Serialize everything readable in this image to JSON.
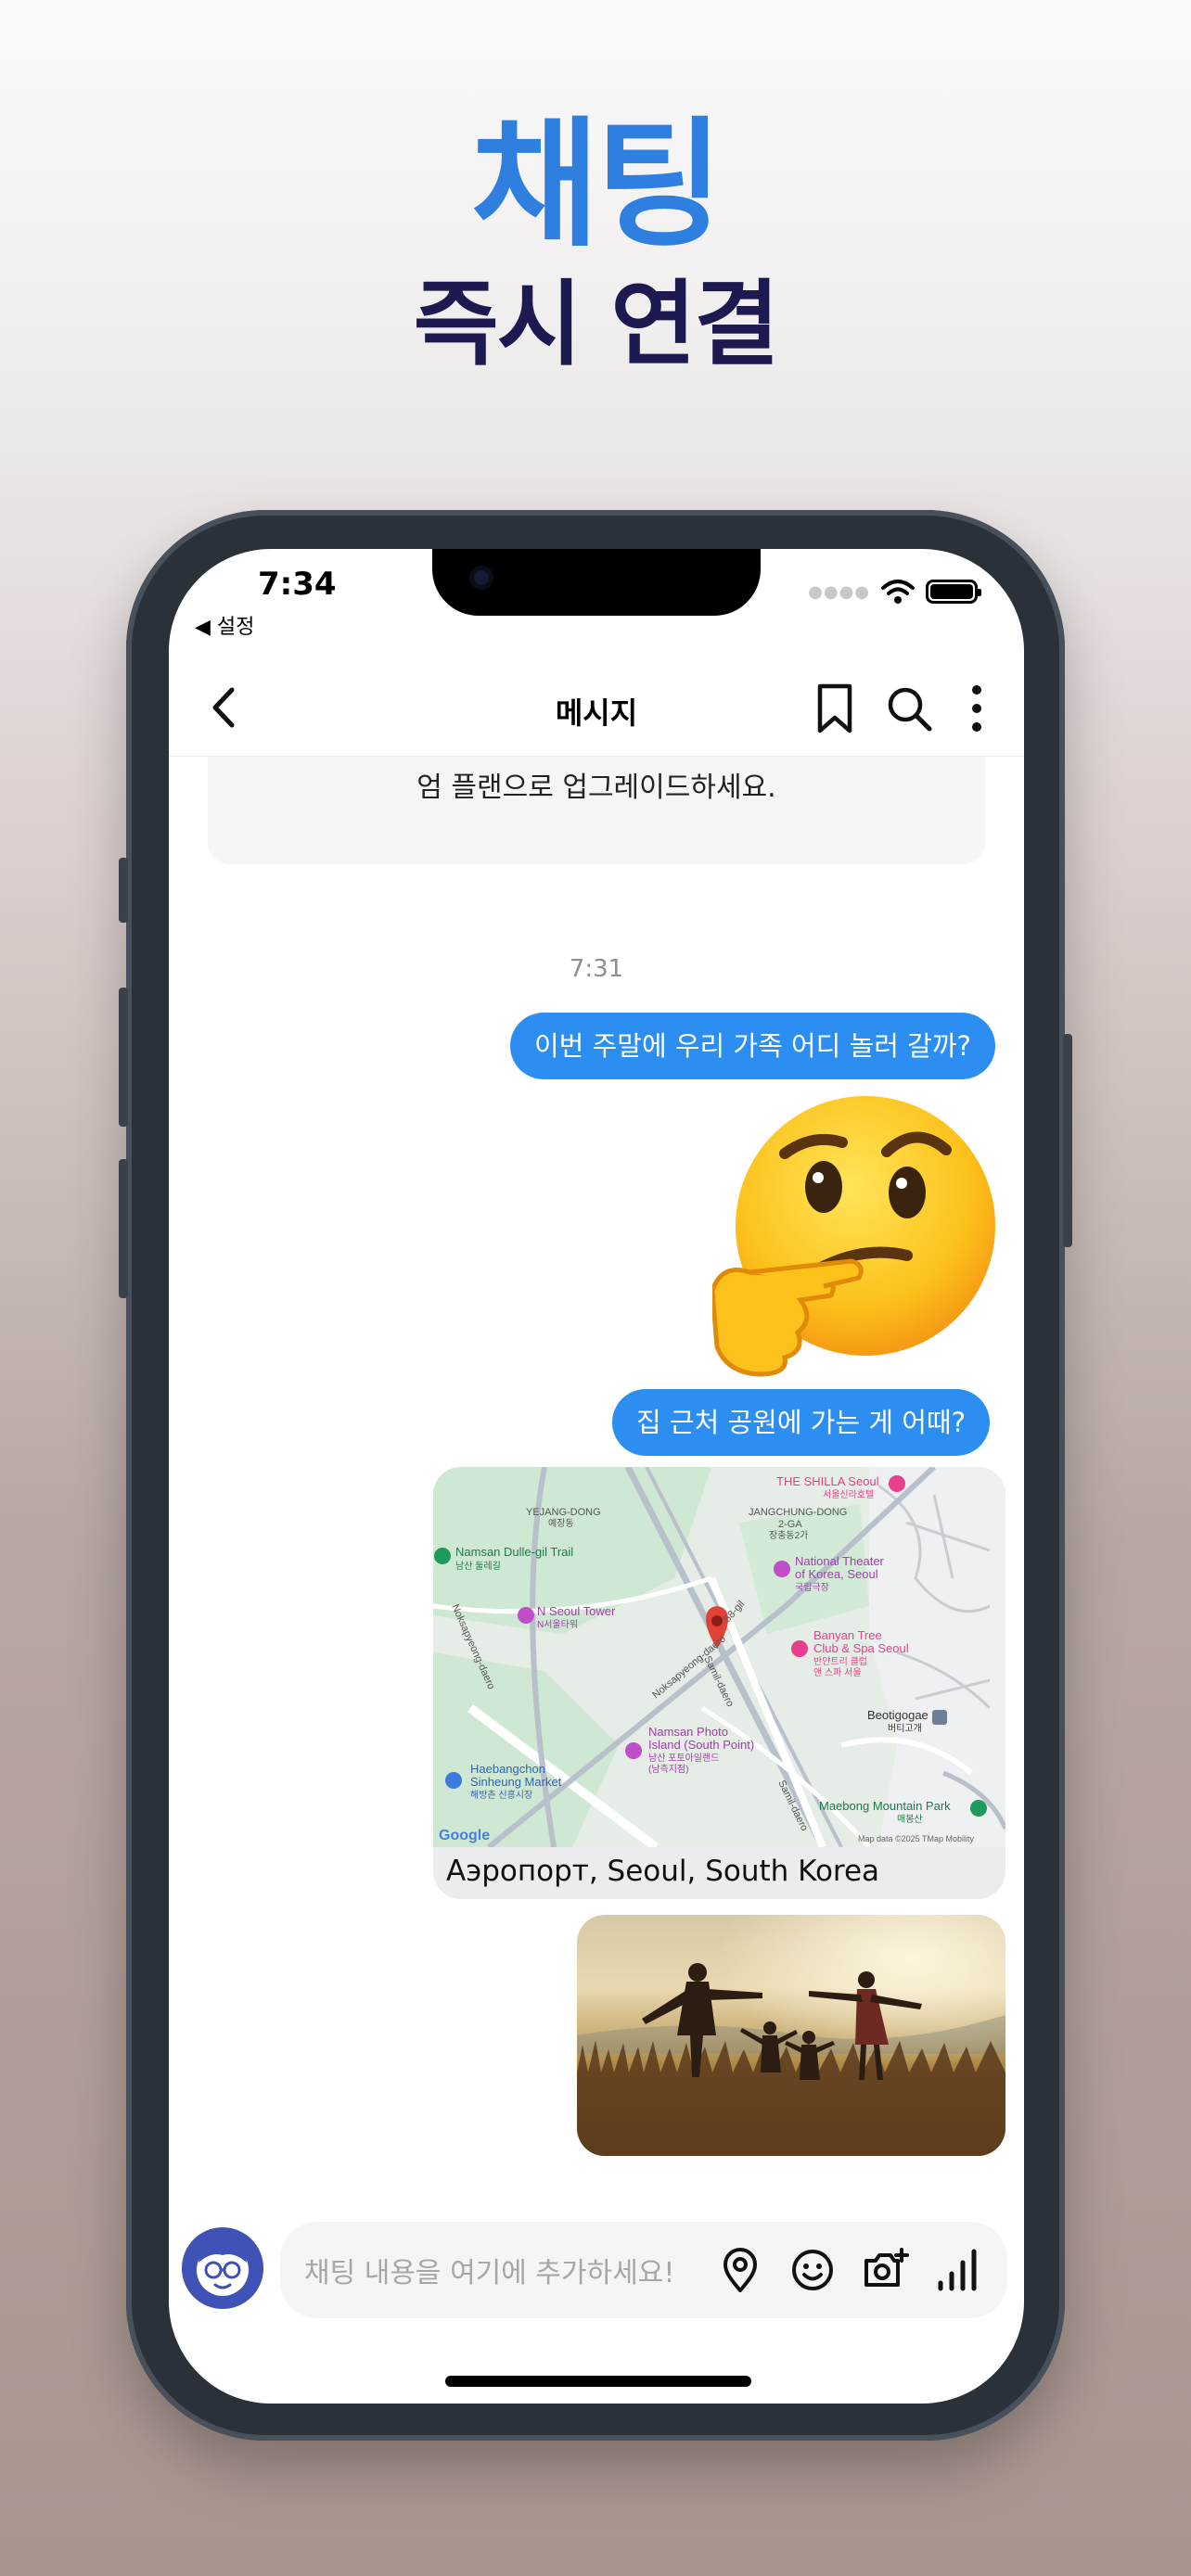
{
  "headline": {
    "title": "채팅",
    "subtitle": "즉시 연결"
  },
  "status_bar": {
    "time": "7:34",
    "back_label": "◀ 설정"
  },
  "nav": {
    "title": "메시지"
  },
  "banner": {
    "text": "엄 플랜으로 업그레이드하세요."
  },
  "chat": {
    "timestamp": "7:31",
    "messages": [
      {
        "text": "이번 주말에 우리 가족 어디 놀러 갈까?"
      },
      {
        "text": "집 근처 공원에 가는 게 어때?"
      }
    ],
    "map": {
      "caption": "Аэропорт, Seoul, South Korea",
      "labels": {
        "shilla": "THE SHILLA Seoul",
        "shilla_kr": "서울신라호텔",
        "jangchung": "JANGCHUNG-DONG",
        "jangchung2": "2-GA",
        "jangchung_kr": "장충동2가",
        "yejang": "YEJANG-DONG",
        "yejang_kr": "예장동",
        "namsan_trail": "Namsan Dulle-gil Trail",
        "namsan_trail_kr": "남산 둘레길",
        "theater": "National Theater",
        "theater2": "of Korea, Seoul",
        "theater_kr": "국립극장",
        "ntower": "N Seoul Tower",
        "ntower_kr": "N서울타워",
        "banyan": "Banyan Tree",
        "banyan2": "Club & Spa Seoul",
        "banyan_kr": "반얀트리 클럽",
        "banyan_kr2": "앤 스파 서울",
        "photo_island": "Namsan Photo",
        "photo_island2": "Island (South Point)",
        "photo_island_kr": "남산 포토아일랜드",
        "photo_island_kr2": "(남측지점)",
        "beotigogae": "Beotigogae",
        "beotigogae_kr": "버티고개",
        "haebangchon": "Haebangchon",
        "haebangchon2": "Sinheung Market",
        "haebangchon_kr": "해방촌 신흥시장",
        "maebong": "Maebong Mountain Park",
        "maebong_kr": "매봉산",
        "road1": "Noksapyeong-daero",
        "road2": "Noksapyeong-daero",
        "road3": "Samil-daero",
        "road4": "Samil-daero",
        "road5": "58-gil",
        "google": "Google",
        "mapdata": "Map data ©2025 TMap Mobility"
      }
    }
  },
  "composer": {
    "placeholder": "채팅 내용을 여기에 추가하세요!"
  },
  "colors": {
    "accent": "#2b8ef0",
    "headline_blue": "#2f7fe0",
    "headline_dark": "#1d1a52"
  },
  "icons": [
    "back-chevron-icon",
    "bookmark-icon",
    "search-icon",
    "more-vertical-icon",
    "location-pin-icon",
    "smiley-icon",
    "camera-plus-icon",
    "bar-chart-icon",
    "avatar-icon",
    "wifi-icon",
    "battery-icon"
  ]
}
